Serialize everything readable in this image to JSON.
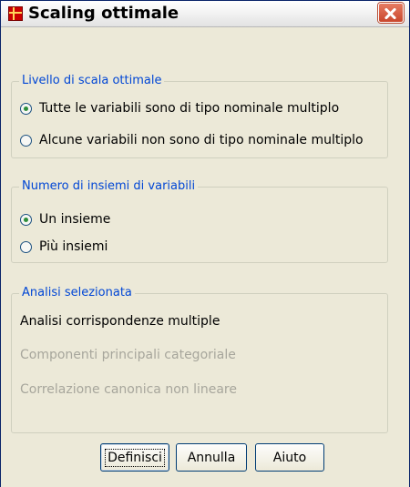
{
  "window": {
    "title": "Scaling ottimale"
  },
  "level_group": {
    "title": "Livello di scala ottimale",
    "options": [
      {
        "label": "Tutte le variabili sono di tipo nominale multiplo",
        "selected": true
      },
      {
        "label": "Alcune variabili non sono di tipo nominale multiplo",
        "selected": false
      }
    ]
  },
  "sets_group": {
    "title": "Numero di insiemi di variabili",
    "options": [
      {
        "label": "Un insieme",
        "selected": true
      },
      {
        "label": "Più insiemi",
        "selected": false
      }
    ]
  },
  "analysis_group": {
    "title": "Analisi selezionata",
    "items": [
      {
        "label": "Analisi corrispondenze multiple",
        "enabled": true
      },
      {
        "label": "Componenti principali categoriale",
        "enabled": false
      },
      {
        "label": "Correlazione canonica non lineare",
        "enabled": false
      }
    ]
  },
  "buttons": {
    "define": "Definisci",
    "cancel": "Annulla",
    "help": "Aiuto"
  }
}
